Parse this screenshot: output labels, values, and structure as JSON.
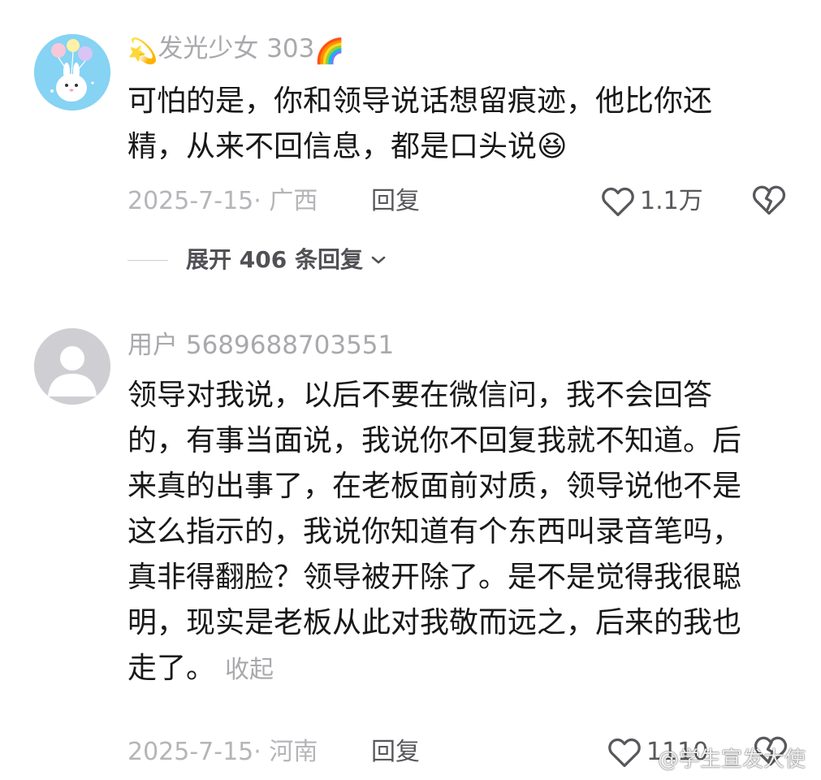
{
  "comments": [
    {
      "username": "发光少女 303",
      "username_prefix_emoji": "💫",
      "username_suffix_emoji": "🌈",
      "lines": [
        "可怕的是，你和领导说话想留痕迹，他比你还",
        "精，从来不回信息，都是口头说"
      ],
      "text_emoji": "😆",
      "date_location": "2025-7-15· 广西",
      "reply_label": "回复",
      "like_count": "1.1万",
      "expand_label": "展开 406 条回复"
    },
    {
      "username": "用户 5689688703551",
      "lines": [
        "领导对我说，以后不要在微信问，我不会回答",
        "的，有事当面说，我说你不回复我就不知道。后",
        "来真的出事了，在老板面前对质，领导说他不是",
        "这么指示的，我说你知道有个东西叫录音笔吗，",
        "真非得翻脸？领导被开除了。是不是觉得我很聪",
        "明，现实是老板从此对我敬而远之，后来的我也",
        "走了。"
      ],
      "collapse_label": "收起",
      "date_location": "2025-7-15· 河南",
      "reply_label": "回复",
      "like_count": "1110"
    }
  ],
  "watermark": "@学生宣发大使",
  "icons": {
    "like": "heart-outline-icon",
    "dislike": "broken-heart-icon",
    "expand": "chevron-down-icon"
  },
  "colors": {
    "username": "#a9a9ad",
    "meta": "#b5b5b9",
    "action": "#58585c",
    "text": "#181818"
  }
}
